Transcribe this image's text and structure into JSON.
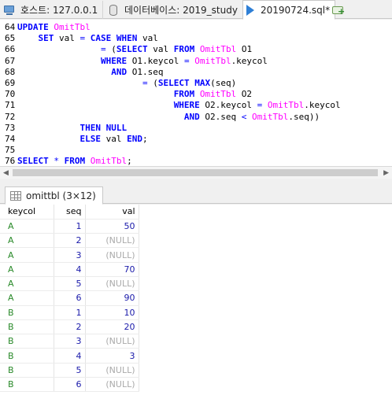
{
  "tabs": {
    "host_label": "호스트: 127.0.0.1",
    "db_label": "데이터베이스: 2019_study",
    "query_label": "20190724.sql*"
  },
  "editor": {
    "lines": [
      {
        "n": "64",
        "tokens": [
          {
            "t": "UPDATE",
            "c": "kw"
          },
          {
            "t": " ",
            "c": "id"
          },
          {
            "t": "OmitTbl",
            "c": "tb"
          }
        ]
      },
      {
        "n": "65",
        "tokens": [
          {
            "t": "    ",
            "c": "id"
          },
          {
            "t": "SET",
            "c": "kw"
          },
          {
            "t": " val ",
            "c": "id"
          },
          {
            "t": "=",
            "c": "op"
          },
          {
            "t": " ",
            "c": "id"
          },
          {
            "t": "CASE",
            "c": "kw"
          },
          {
            "t": " ",
            "c": "id"
          },
          {
            "t": "WHEN",
            "c": "kw"
          },
          {
            "t": " val",
            "c": "id"
          }
        ]
      },
      {
        "n": "66",
        "tokens": [
          {
            "t": "                ",
            "c": "id"
          },
          {
            "t": "=",
            "c": "op"
          },
          {
            "t": " (",
            "c": "id"
          },
          {
            "t": "SELECT",
            "c": "kw"
          },
          {
            "t": " val ",
            "c": "id"
          },
          {
            "t": "FROM",
            "c": "kw"
          },
          {
            "t": " ",
            "c": "id"
          },
          {
            "t": "OmitTbl",
            "c": "tb"
          },
          {
            "t": " O1",
            "c": "id"
          }
        ]
      },
      {
        "n": "67",
        "tokens": [
          {
            "t": "                ",
            "c": "id"
          },
          {
            "t": "WHERE",
            "c": "kw"
          },
          {
            "t": " O1.keycol ",
            "c": "id"
          },
          {
            "t": "=",
            "c": "op"
          },
          {
            "t": " ",
            "c": "id"
          },
          {
            "t": "OmitTbl",
            "c": "tb"
          },
          {
            "t": ".keycol",
            "c": "id"
          }
        ]
      },
      {
        "n": "68",
        "tokens": [
          {
            "t": "                  ",
            "c": "id"
          },
          {
            "t": "AND",
            "c": "kw"
          },
          {
            "t": " O1.seq",
            "c": "id"
          }
        ]
      },
      {
        "n": "69",
        "tokens": [
          {
            "t": "                        ",
            "c": "id"
          },
          {
            "t": "=",
            "c": "op"
          },
          {
            "t": " (",
            "c": "id"
          },
          {
            "t": "SELECT",
            "c": "kw"
          },
          {
            "t": " ",
            "c": "id"
          },
          {
            "t": "MAX",
            "c": "kw"
          },
          {
            "t": "(seq)",
            "c": "id"
          }
        ]
      },
      {
        "n": "70",
        "tokens": [
          {
            "t": "                              ",
            "c": "id"
          },
          {
            "t": "FROM",
            "c": "kw"
          },
          {
            "t": " ",
            "c": "id"
          },
          {
            "t": "OmitTbl",
            "c": "tb"
          },
          {
            "t": " O2",
            "c": "id"
          }
        ]
      },
      {
        "n": "71",
        "tokens": [
          {
            "t": "                              ",
            "c": "id"
          },
          {
            "t": "WHERE",
            "c": "kw"
          },
          {
            "t": " O2.keycol ",
            "c": "id"
          },
          {
            "t": "=",
            "c": "op"
          },
          {
            "t": " ",
            "c": "id"
          },
          {
            "t": "OmitTbl",
            "c": "tb"
          },
          {
            "t": ".keycol",
            "c": "id"
          }
        ]
      },
      {
        "n": "72",
        "tokens": [
          {
            "t": "                                ",
            "c": "id"
          },
          {
            "t": "AND",
            "c": "kw"
          },
          {
            "t": " O2.seq ",
            "c": "id"
          },
          {
            "t": "<",
            "c": "op"
          },
          {
            "t": " ",
            "c": "id"
          },
          {
            "t": "OmitTbl",
            "c": "tb"
          },
          {
            "t": ".seq))",
            "c": "id"
          }
        ]
      },
      {
        "n": "73",
        "tokens": [
          {
            "t": "            ",
            "c": "id"
          },
          {
            "t": "THEN",
            "c": "kw"
          },
          {
            "t": " ",
            "c": "id"
          },
          {
            "t": "NULL",
            "c": "kw"
          }
        ]
      },
      {
        "n": "74",
        "tokens": [
          {
            "t": "            ",
            "c": "id"
          },
          {
            "t": "ELSE",
            "c": "kw"
          },
          {
            "t": " val ",
            "c": "id"
          },
          {
            "t": "END",
            "c": "kw"
          },
          {
            "t": ";",
            "c": "id"
          }
        ]
      },
      {
        "n": "75",
        "tokens": []
      },
      {
        "n": "76",
        "tokens": [
          {
            "t": "SELECT",
            "c": "kw"
          },
          {
            "t": " ",
            "c": "id"
          },
          {
            "t": "*",
            "c": "op"
          },
          {
            "t": " ",
            "c": "id"
          },
          {
            "t": "FROM",
            "c": "kw"
          },
          {
            "t": " ",
            "c": "id"
          },
          {
            "t": "OmitTbl",
            "c": "tb"
          },
          {
            "t": ";",
            "c": "id"
          }
        ]
      }
    ]
  },
  "result": {
    "tab_label": "omittbl (3×12)",
    "columns": [
      "keycol",
      "seq",
      "val"
    ],
    "rows": [
      [
        "A",
        "1",
        "50"
      ],
      [
        "A",
        "2",
        "(NULL)"
      ],
      [
        "A",
        "3",
        "(NULL)"
      ],
      [
        "A",
        "4",
        "70"
      ],
      [
        "A",
        "5",
        "(NULL)"
      ],
      [
        "A",
        "6",
        "90"
      ],
      [
        "B",
        "1",
        "10"
      ],
      [
        "B",
        "2",
        "20"
      ],
      [
        "B",
        "3",
        "(NULL)"
      ],
      [
        "B",
        "4",
        "3"
      ],
      [
        "B",
        "5",
        "(NULL)"
      ],
      [
        "B",
        "6",
        "(NULL)"
      ]
    ],
    "null_marker": "(NULL)"
  }
}
